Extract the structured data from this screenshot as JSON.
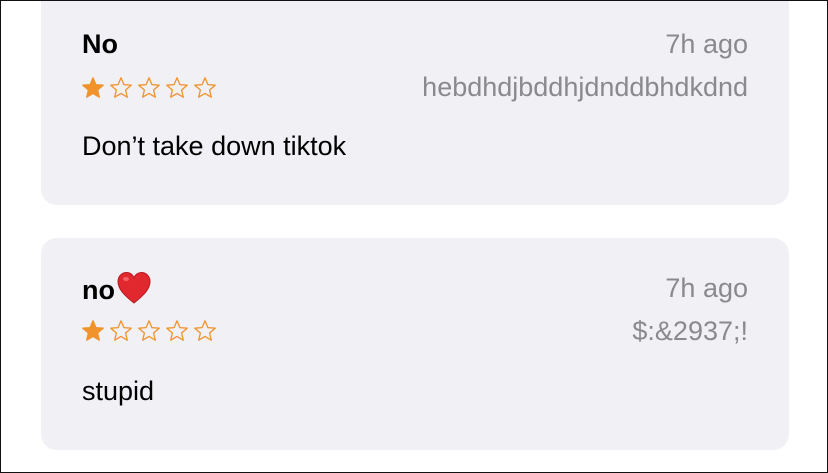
{
  "reviews": [
    {
      "title": "No",
      "time": "7h ago",
      "author": "hebdhdjbddhjdnddbhdkdnd",
      "rating": 1,
      "max_rating": 5,
      "body": "Don’t take down tiktok"
    },
    {
      "title": "no",
      "title_emoji": "heart-emoji",
      "time": "7h ago",
      "author": "$:&2937;!",
      "rating": 1,
      "max_rating": 5,
      "body": "stupid"
    }
  ],
  "colors": {
    "card_background": "#f0f0f5",
    "star": "#f0932b",
    "secondary_text": "#8a8a8e",
    "primary_text": "#000000",
    "heart": "#e0282e"
  }
}
